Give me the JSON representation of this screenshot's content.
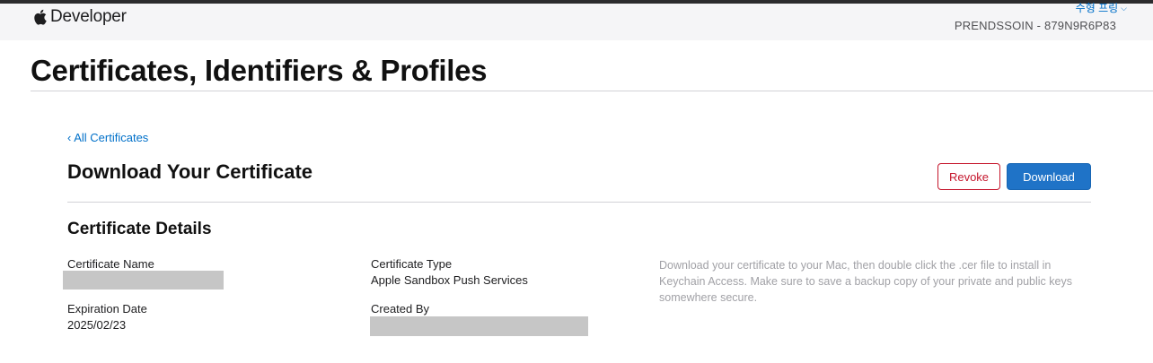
{
  "header": {
    "brand_label": "Developer",
    "account_name": "수형 프링",
    "team_id": "PRENDSSOIN - 879N9R6P83"
  },
  "page": {
    "title": "Certificates, Identifiers & Profiles"
  },
  "nav": {
    "back_link": "‹ All Certificates"
  },
  "main": {
    "section_title": "Download Your Certificate",
    "revoke_label": "Revoke",
    "download_label": "Download"
  },
  "details": {
    "title": "Certificate Details",
    "certificate_name_label": "Certificate Name",
    "certificate_type_label": "Certificate Type",
    "certificate_type_value": "Apple Sandbox Push Services",
    "expiration_date_label": "Expiration Date",
    "expiration_date_value": "2025/02/23",
    "created_by_label": "Created By",
    "help_text": "Download your certificate to your Mac, then double click the .cer file to install in Keychain Access. Make sure to save a backup copy of your private and public keys somewhere secure."
  },
  "colors": {
    "link": "#0070c9",
    "revoke": "#c5162c",
    "download_bg": "#1f73c7",
    "topbar_bg": "#f5f5f7",
    "redacted": "#c6c6c6"
  },
  "icons": {
    "brand": "apple-logo-icon",
    "account_menu": "chevron-down-icon"
  }
}
